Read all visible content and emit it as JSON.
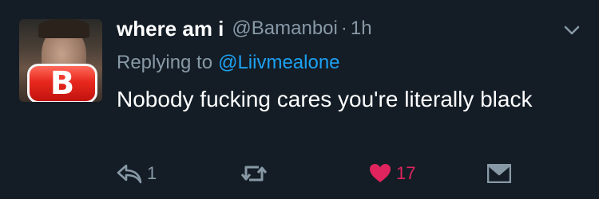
{
  "tweet": {
    "display_name": "where am i",
    "handle": "@Bamanboi",
    "separator": "·",
    "time": "1h",
    "reply_prefix": "Replying to",
    "reply_mention": "@Liivmealone",
    "text": "Nobody fucking cares you're literally black",
    "avatar_badge_letter": "B"
  },
  "actions": {
    "reply_count": "1",
    "retweet_count": "",
    "like_count": "17",
    "icons": {
      "reply": "reply-icon",
      "retweet": "retweet-icon",
      "like": "heart-icon",
      "message": "envelope-icon",
      "menu": "chevron-down-icon"
    }
  },
  "colors": {
    "background": "#141d26",
    "secondary_text": "#8899a6",
    "link": "#1da1f2",
    "like_active": "#e0245e"
  }
}
